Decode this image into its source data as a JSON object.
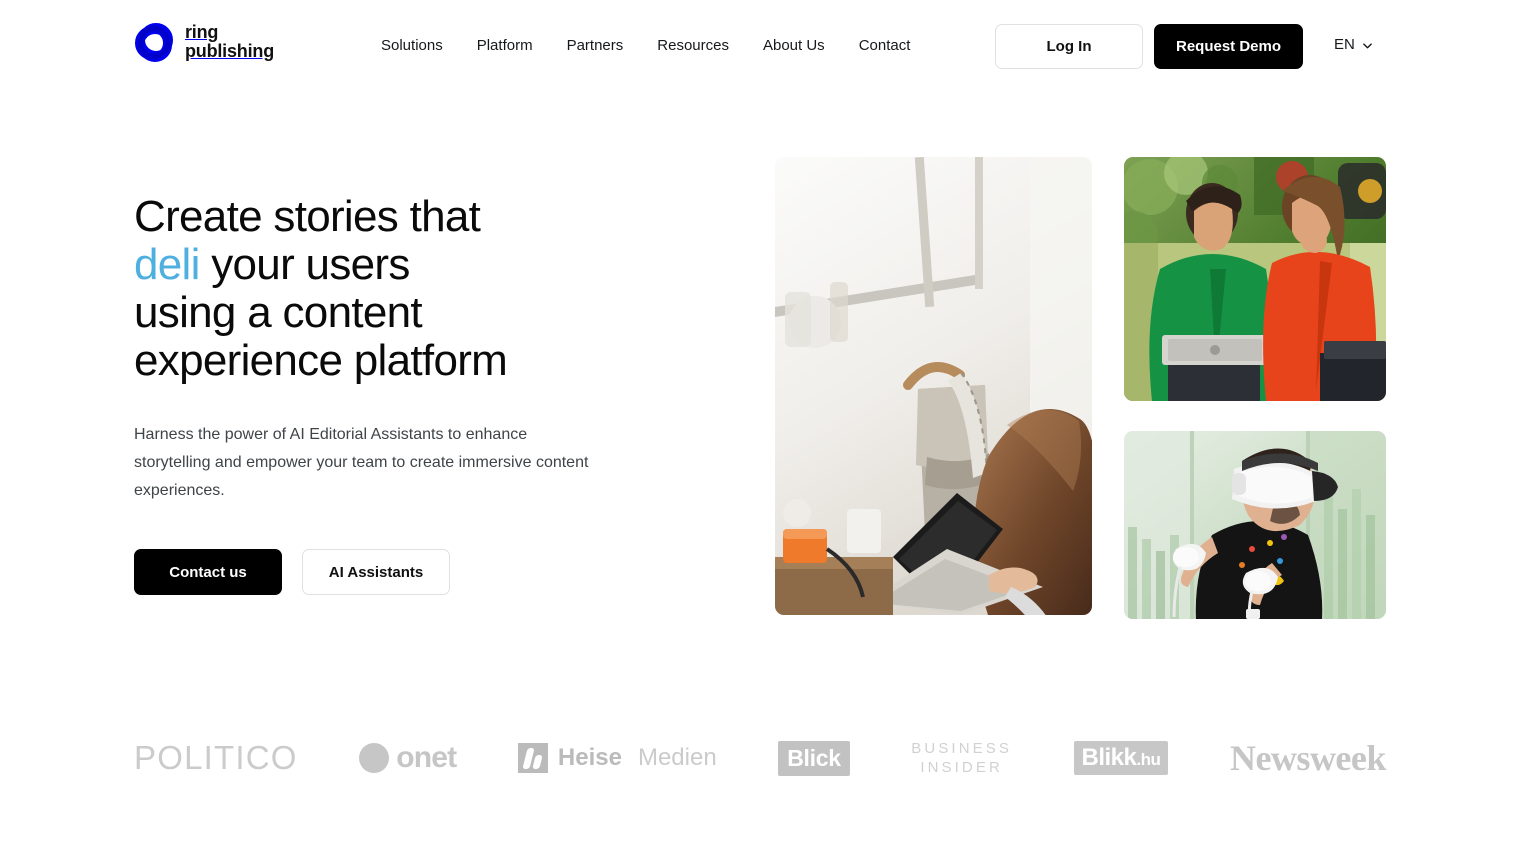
{
  "brand": {
    "logo_line1": "ring",
    "logo_line2": "publishing",
    "mark_icon": "ring-logo-icon",
    "colors": {
      "accent_blue": "#4fb0e0",
      "cyan": "#19c6d8",
      "magenta": "#e8309a",
      "yellow": "#f2d200",
      "black": "#000000"
    }
  },
  "header": {
    "nav": [
      {
        "label": "Solutions"
      },
      {
        "label": "Platform"
      },
      {
        "label": "Partners"
      },
      {
        "label": "Resources"
      },
      {
        "label": "About Us"
      },
      {
        "label": "Contact"
      }
    ],
    "login_label": "Log In",
    "demo_label": "Request Demo",
    "language": {
      "value": "EN",
      "icon": "chevron-down-icon"
    }
  },
  "hero": {
    "headline": {
      "line1": "Create stories that",
      "accent_word": "deli",
      "line2_rest": " your users",
      "line3": "using a content",
      "line4": "experience platform"
    },
    "lede": "Harness the power of AI Editorial Assistants to enhance storytelling and empower your team to create immersive content experiences.",
    "cta_primary": "Contact us",
    "cta_secondary": "AI Assistants",
    "images": [
      {
        "name": "woman-working-on-laptop-in-cafe"
      },
      {
        "name": "two-women-laughing-with-laptops"
      },
      {
        "name": "man-using-vr-headset-and-controllers"
      }
    ]
  },
  "clients": {
    "logos": [
      {
        "name": "politico-logo",
        "text": "POLITICO"
      },
      {
        "name": "onet-logo",
        "text": "onet"
      },
      {
        "name": "heise-medien-logo",
        "text_bold": "Heise",
        "text_light": "Medien"
      },
      {
        "name": "blick-logo",
        "text": "Blick"
      },
      {
        "name": "business-insider-logo",
        "line1": "BUSINESS",
        "line2": "INSIDER"
      },
      {
        "name": "blikk-hu-logo",
        "text": "Blikk",
        "suffix": ".hu"
      },
      {
        "name": "newsweek-logo",
        "text": "Newsweek"
      }
    ]
  }
}
